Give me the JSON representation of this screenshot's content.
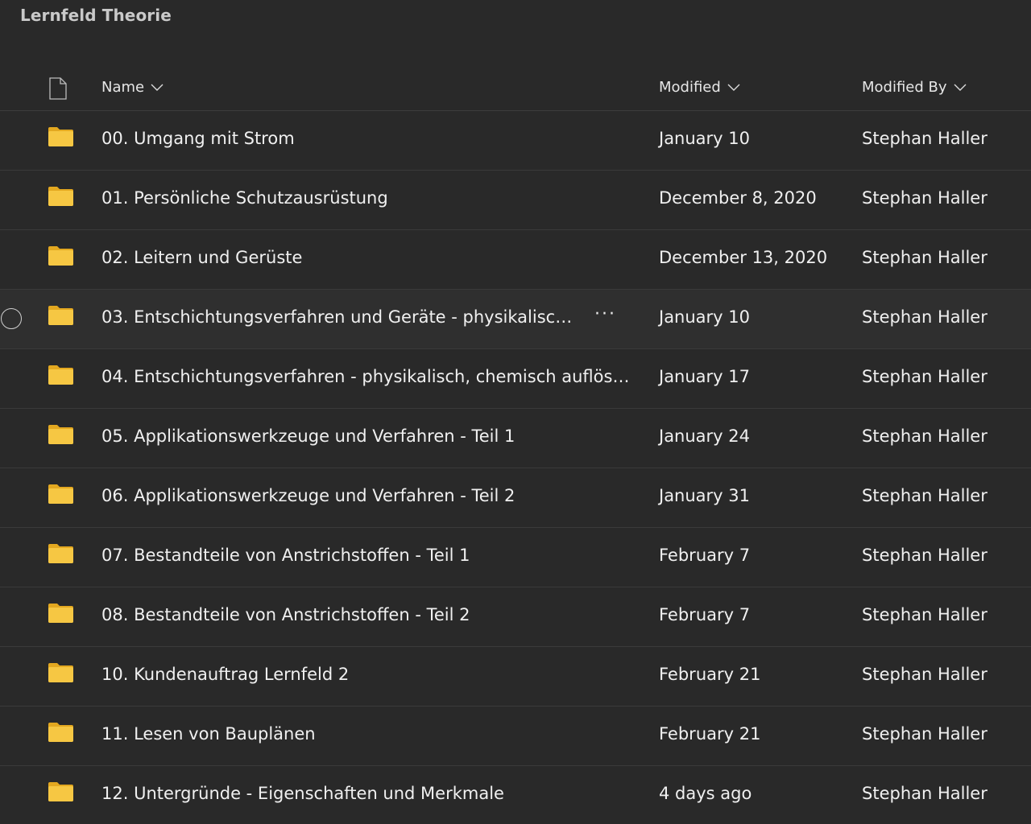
{
  "title": "Lernfeld Theorie",
  "columns": {
    "name": "Name",
    "modified": "Modified",
    "modified_by": "Modified By"
  },
  "colors": {
    "background": "#292929",
    "folder": "#f6c743",
    "folder_back": "#e3a820"
  },
  "rows": [
    {
      "name": "00. Umgang mit Strom",
      "modified": "January 10",
      "modified_by": "Stephan Haller"
    },
    {
      "name": "01. Persönliche Schutzausrüstung",
      "modified": "December 8, 2020",
      "modified_by": "Stephan Haller"
    },
    {
      "name": "02. Leitern und Gerüste",
      "modified": "December 13, 2020",
      "modified_by": "Stephan Haller"
    },
    {
      "name": "03. Entschichtungsverfahren und Geräte - physikalisch-...",
      "modified": "January 10",
      "modified_by": "Stephan Haller",
      "more": "···"
    },
    {
      "name": "04. Entschichtungsverfahren - physikalisch, chemisch auflösend",
      "modified": "January 17",
      "modified_by": "Stephan Haller"
    },
    {
      "name": "05. Applikationswerkzeuge und Verfahren - Teil 1",
      "modified": "January 24",
      "modified_by": "Stephan Haller"
    },
    {
      "name": "06. Applikationswerkzeuge und Verfahren - Teil 2",
      "modified": "January 31",
      "modified_by": "Stephan Haller"
    },
    {
      "name": "07. Bestandteile von Anstrichstoffen - Teil 1",
      "modified": "February 7",
      "modified_by": "Stephan Haller"
    },
    {
      "name": "08. Bestandteile von Anstrichstoffen - Teil 2",
      "modified": "February 7",
      "modified_by": "Stephan Haller"
    },
    {
      "name": "10. Kundenauftrag Lernfeld 2",
      "modified": "February 21",
      "modified_by": "Stephan Haller"
    },
    {
      "name": "11. Lesen von Bauplänen",
      "modified": "February 21",
      "modified_by": "Stephan Haller"
    },
    {
      "name": "12. Untergründe - Eigenschaften und Merkmale",
      "modified": "4 days ago",
      "modified_by": "Stephan Haller"
    }
  ]
}
